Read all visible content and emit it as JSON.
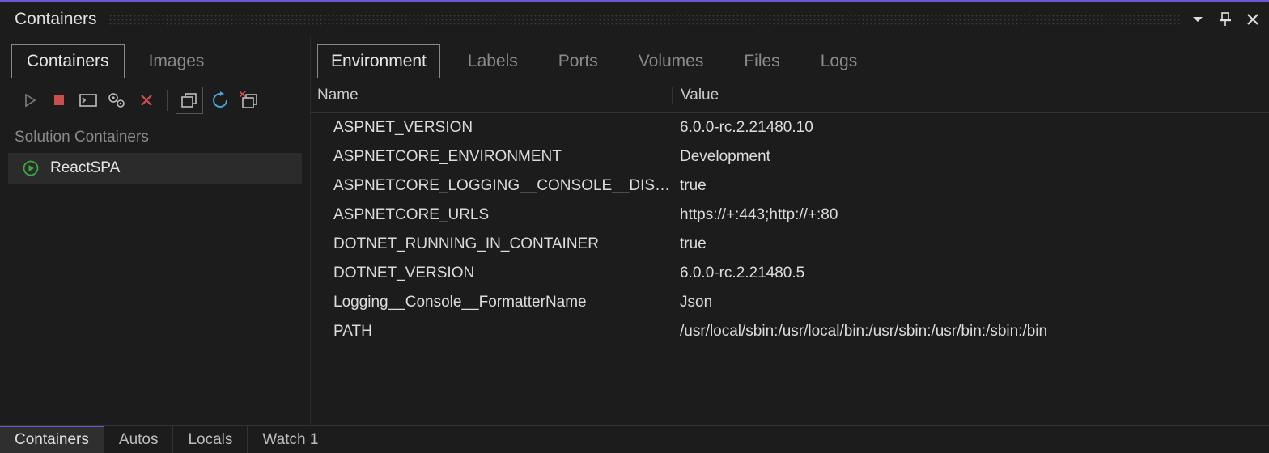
{
  "panel": {
    "title": "Containers"
  },
  "leftTabs": [
    {
      "label": "Containers",
      "active": true
    },
    {
      "label": "Images",
      "active": false
    }
  ],
  "sidebar": {
    "section_label": "Solution Containers",
    "items": [
      {
        "label": "ReactSPA"
      }
    ]
  },
  "rightTabs": [
    {
      "label": "Environment",
      "active": true
    },
    {
      "label": "Labels",
      "active": false
    },
    {
      "label": "Ports",
      "active": false
    },
    {
      "label": "Volumes",
      "active": false
    },
    {
      "label": "Files",
      "active": false
    },
    {
      "label": "Logs",
      "active": false
    }
  ],
  "envTable": {
    "headers": {
      "name": "Name",
      "value": "Value"
    },
    "rows": [
      {
        "name": "ASPNET_VERSION",
        "value": "6.0.0-rc.2.21480.10"
      },
      {
        "name": "ASPNETCORE_ENVIRONMENT",
        "value": "Development"
      },
      {
        "name": "ASPNETCORE_LOGGING__CONSOLE__DISA...",
        "value": "true"
      },
      {
        "name": "ASPNETCORE_URLS",
        "value": "https://+:443;http://+:80"
      },
      {
        "name": "DOTNET_RUNNING_IN_CONTAINER",
        "value": "true"
      },
      {
        "name": "DOTNET_VERSION",
        "value": "6.0.0-rc.2.21480.5"
      },
      {
        "name": "Logging__Console__FormatterName",
        "value": "Json"
      },
      {
        "name": "PATH",
        "value": "/usr/local/sbin:/usr/local/bin:/usr/sbin:/usr/bin:/sbin:/bin"
      }
    ]
  },
  "bottomTabs": [
    {
      "label": "Containers",
      "active": true
    },
    {
      "label": "Autos",
      "active": false
    },
    {
      "label": "Locals",
      "active": false
    },
    {
      "label": "Watch 1",
      "active": false
    }
  ]
}
